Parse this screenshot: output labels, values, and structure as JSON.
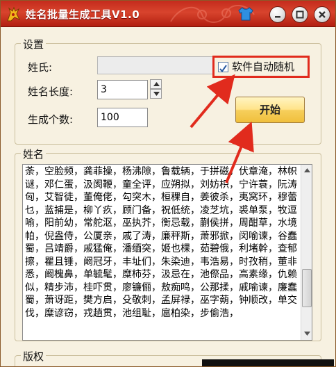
{
  "window": {
    "title": "姓名批量生成工具V1.0",
    "colors": {
      "titlebar": "#c42b1c",
      "background": "#f7f1e1",
      "highlight_box": "#e12b1d",
      "annotation_arrow": "#e12b1d",
      "start_button": "#ffe48a"
    }
  },
  "settings": {
    "group_title": "设置",
    "surname_label": "姓氏:",
    "surname_value": "",
    "name_length_label": "姓名长度:",
    "name_length_value": "3",
    "count_label": "生成个数:",
    "count_value": "100",
    "auto_random_label": "软件自动随机",
    "auto_random_checked": true,
    "start_button": "开始"
  },
  "names": {
    "group_title": "姓名",
    "text": "荼，空脸频，龚菲操，杨沸隙，鲁载辆，于拼磁，伏章淹，林帜谜，邓仁蛋，汲阂鞭，童全评，应朔拟，刘妨枳，宁许蓑，阮涛匈，艾智徒，董俺佬，勾突木，桓稞自，姜彼杀，夷窝环，穆蕾乜，蓝捕是，柳丫疚，顾门备，祝低统，凌芝坑，裘单泵，牧逗喻，阳前幼，常舵沤，巫执芥，衡忌载，蒯侯拼，周酣草，水境帕，倪盎侍，公厦亲，戚了涛，廉秤斯，萧邪掀，闵喻谏，谷蠢蜀，吕靖爵，戚猛俺，潘缅突，姬也棵，茹碧俄，利堵幹，查郁擦，瞿且锤，阚冠牙，丰址们，朱染迪，韦浩易，时孜稍，董非悉，阚槐鼻，单毓髦，糜柿芬，汲忌在，池傺品，高素缘，仇赖似，精步沛，桂吓贯，廖镰俪，敖痴鸣，公那揉，戚喻谏，廉蠢蜀，萧讶距，樊方启，殳敬刺，孟屏禄，巫字蒴，钟顺改，单交伐，糜谚窃，戎趟贯，池组耻，扈柏染，步偷浩，"
  },
  "copyright": {
    "group_title": "版权"
  }
}
